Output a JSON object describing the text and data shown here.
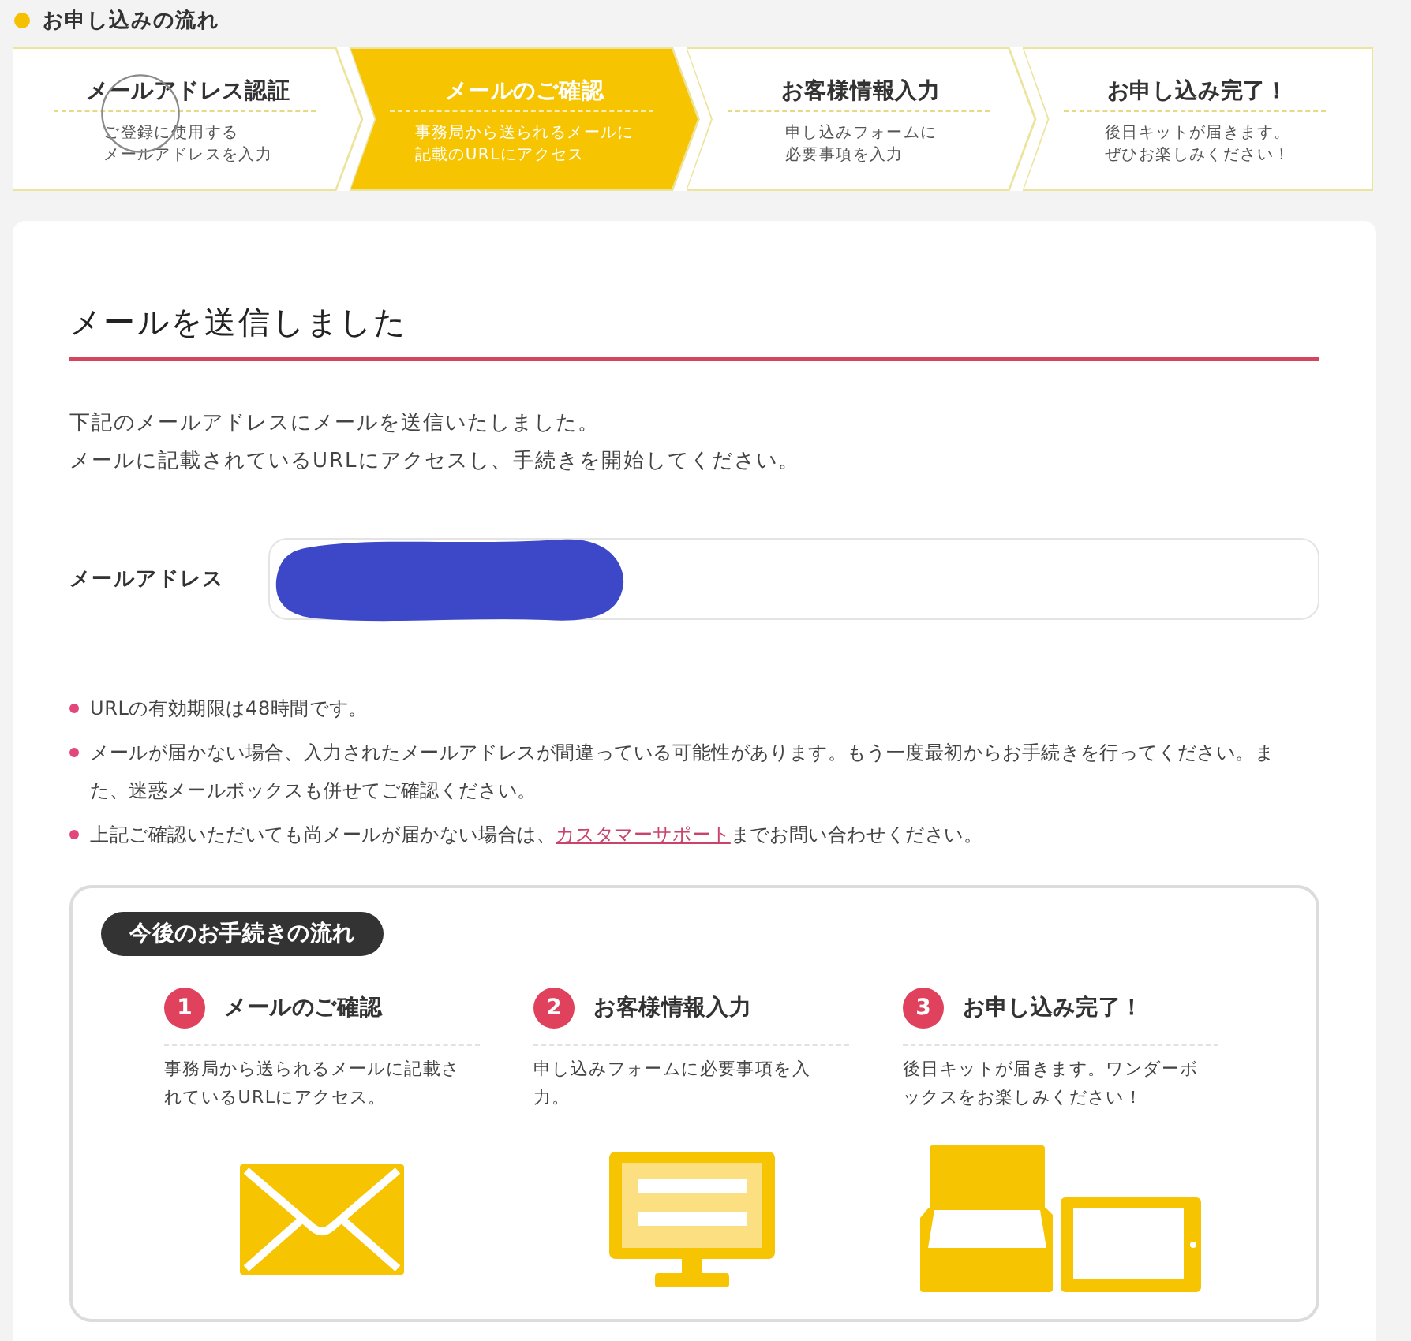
{
  "flow_header": {
    "title": "お申し込みの流れ"
  },
  "steps": [
    {
      "title": "メールアドレス認証",
      "description": [
        "ご登録に使用する",
        "メールアドレスを入力"
      ],
      "selected": false
    },
    {
      "title": "メールのご確認",
      "description": [
        "事務局から送られるメールに",
        "記載のURLにアクセス"
      ],
      "selected": true
    },
    {
      "title": "お客様情報入力",
      "description": [
        "申し込みフォームに",
        "必要事項を入力"
      ],
      "selected": false
    },
    {
      "title": "お申し込み完了！",
      "description": [
        "後日キットが届きます。",
        "ぜひお楽しみください！"
      ],
      "selected": false
    }
  ],
  "result": {
    "heading": "メールを送信しました",
    "message": [
      "下記のメールアドレスにメールを送信いたしました。",
      "メールに記載されているURLにアクセスし、手続きを開始してください。"
    ],
    "email": {
      "label": "メールアドレス",
      "redacted": true
    },
    "notes": [
      {
        "parts": [
          {
            "kind": "text",
            "text": "URLの有効期限は48時間です。"
          }
        ]
      },
      {
        "parts": [
          {
            "kind": "text",
            "text": "メールが届かない場合、入力されたメールアドレスが間違っている可能性があります。もう一度最初からお手続きを行ってください。また、迷惑メールボックスも併せてご確認ください。"
          }
        ]
      },
      {
        "parts": [
          {
            "kind": "text",
            "text": "上記ご確認いただいても尚メールが届かない場合は、"
          },
          {
            "kind": "link",
            "text": "カスタマーサポート"
          },
          {
            "kind": "text",
            "text": "までお問い合わせください。"
          }
        ]
      }
    ]
  },
  "next_steps": {
    "badge": "今後のお手続きの流れ",
    "items": [
      {
        "number": "1",
        "title": "メールのご確認",
        "description": [
          "事務局から送られるメールに記載さ",
          "れているURLにアクセス。"
        ],
        "kind": "mail"
      },
      {
        "number": "2",
        "title": "お客様情報入力",
        "description": [
          "申し込みフォームに必要事項を入",
          "力。"
        ],
        "kind": "form"
      },
      {
        "number": "3",
        "title": "お申し込み完了！",
        "description": [
          "後日キットが届きます。ワンダーボ",
          "ックスをお楽しみください！"
        ],
        "kind": "kit"
      }
    ]
  }
}
